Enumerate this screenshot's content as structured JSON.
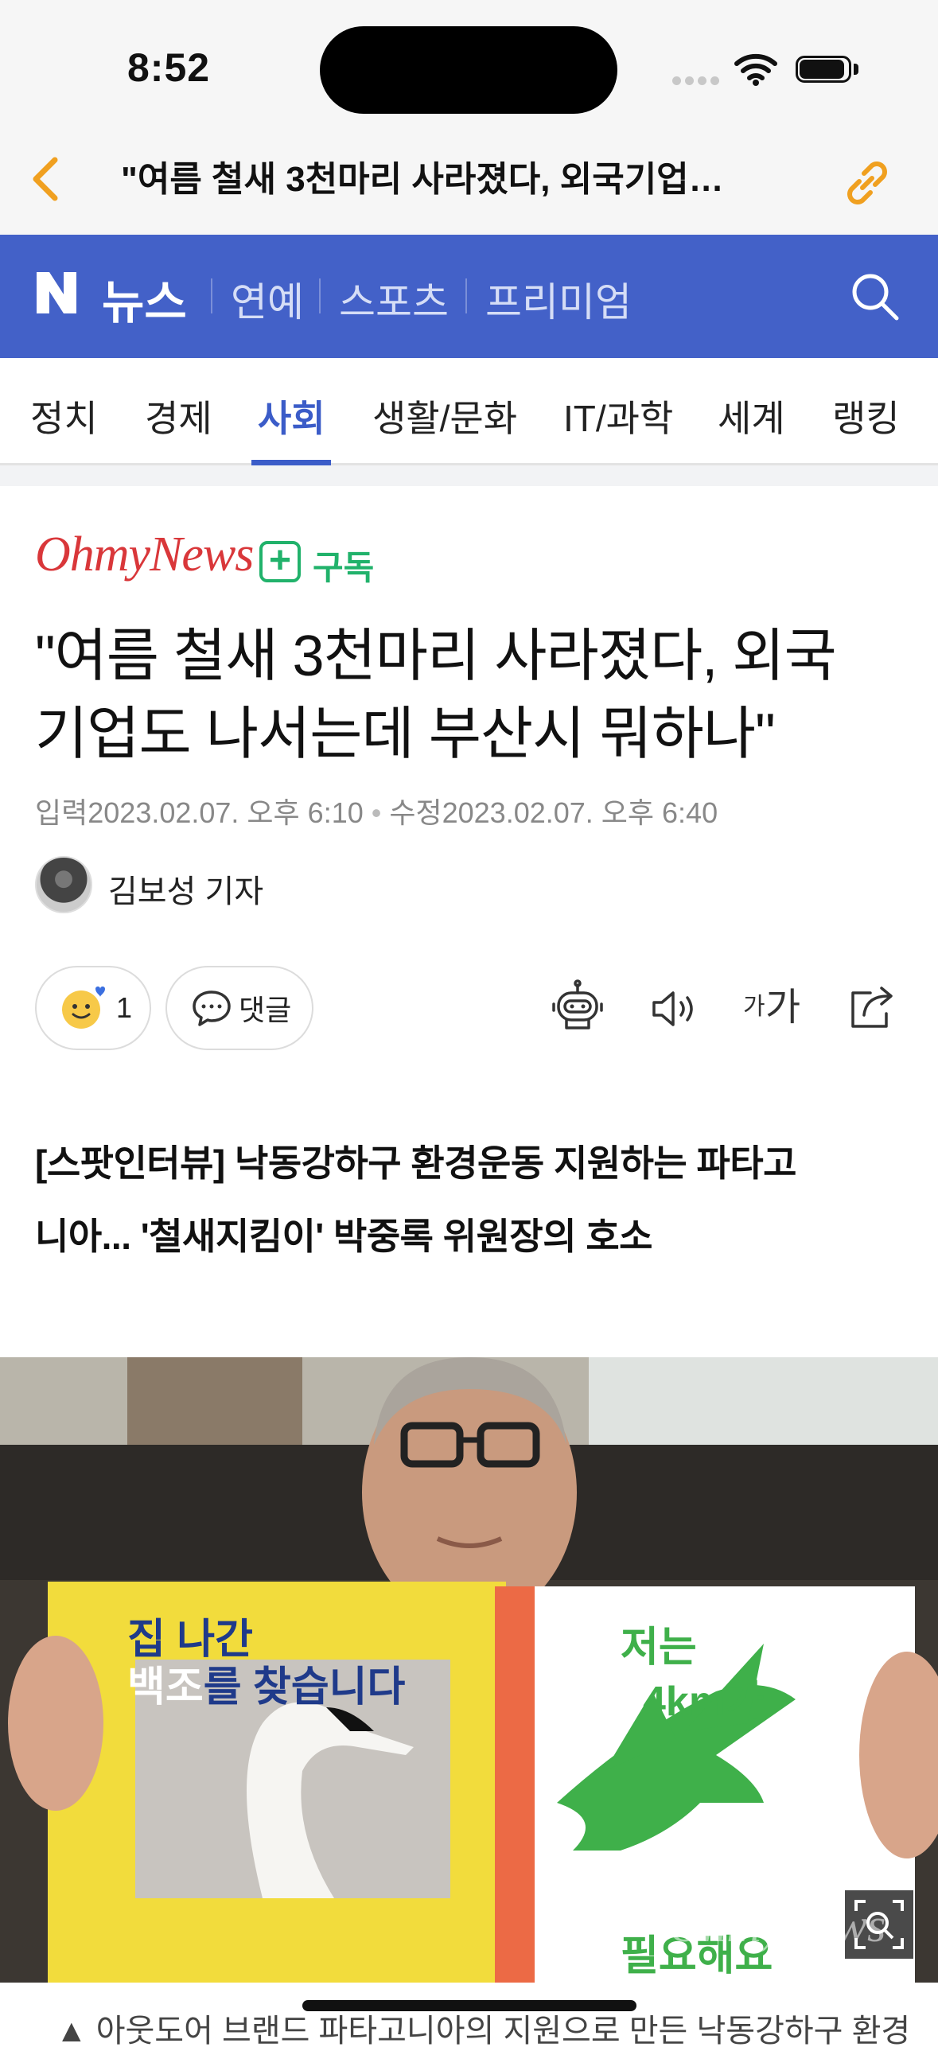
{
  "status_bar": {
    "time": "8:52"
  },
  "browser": {
    "page_title": "\"여름 철새 3천마리 사라졌다, 외국기업…"
  },
  "naver": {
    "logo_letter": "N",
    "news_label": "뉴스",
    "sections": [
      "연예",
      "스포츠",
      "프리미엄"
    ]
  },
  "categories": [
    "정치",
    "경제",
    "사회",
    "생활/문화",
    "IT/과학",
    "세계",
    "랭킹"
  ],
  "active_category": "사회",
  "article": {
    "press": "OhmyNews",
    "subscribe_label": "구독",
    "headline_line1": "\"여름 철새 3천마리 사라졌다, 외국",
    "headline_line2": "기업도 나서는데 부산시 뭐하나\"",
    "input_label": "입력",
    "input_date": "2023.02.07. 오후 6:10",
    "modified_label": "수정",
    "modified_date": "2023.02.07. 오후 6:40",
    "reporter": "김보성 기자",
    "reaction_count": "1",
    "comment_label": "댓글",
    "font_small": "가",
    "font_large": "가",
    "subhead_line1": "[스팟인터뷰] 낙동강하구 환경운동 지원하는 파타고",
    "subhead_line2": "니아... '철새지킴이' 박중록 위원장의 호소",
    "photo": {
      "poster_left_line1": "집 나간",
      "poster_left_line2_a": "백조",
      "poster_left_line2_b": "를 찾습니다",
      "poster_right_line1": "저는",
      "poster_right_line2": "4km가",
      "poster_right_line3": "필요해요",
      "watermark": "OhmyNews"
    },
    "caption": "▲ 아웃도어 브랜드 파타고니아의 지원으로 만든 낙동강하구 환경"
  },
  "colors": {
    "naver_blue": "#4361c8",
    "active_tab": "#3b5cc8",
    "press_red": "#d9373a",
    "subscribe_green": "#21b26b",
    "accent_orange": "#f0a020"
  }
}
